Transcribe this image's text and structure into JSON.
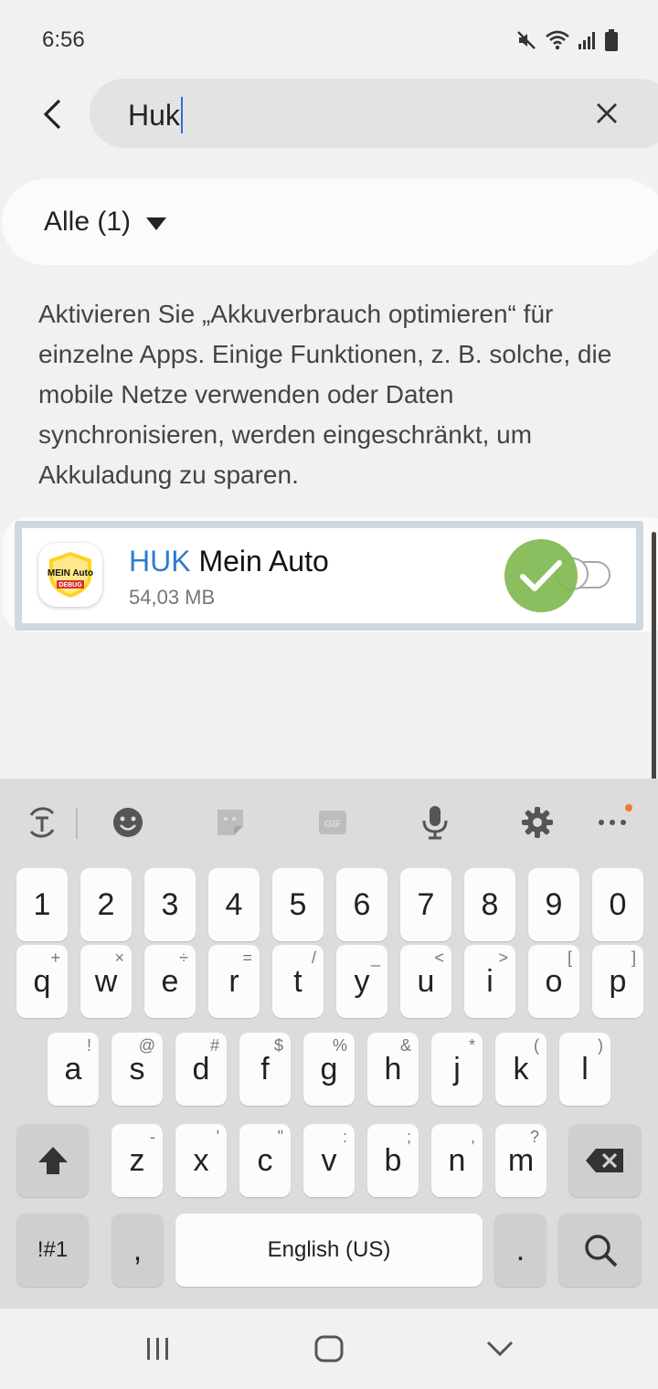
{
  "status": {
    "time": "6:56"
  },
  "search": {
    "query": "Huk"
  },
  "filter": {
    "label": "Alle (1)"
  },
  "description": "Aktivieren Sie „Akkuverbrauch optimieren“ für einzelne Apps. Einige Funktionen, z. B. solche, die mobile Netze verwenden oder Daten synchronisieren, werden eingeschränkt, um Akkuladung zu sparen.",
  "app": {
    "name_highlight": "HUK",
    "name_rest": " Mein Auto",
    "size": "54,03 MB",
    "icon_text_top": "MEIN Auto",
    "icon_text_bottom": "DEBUG",
    "toggle_on": false
  },
  "keyboard": {
    "numbers": [
      "1",
      "2",
      "3",
      "4",
      "5",
      "6",
      "7",
      "8",
      "9",
      "0"
    ],
    "row1": [
      {
        "k": "q",
        "s": "+"
      },
      {
        "k": "w",
        "s": "×"
      },
      {
        "k": "e",
        "s": "÷"
      },
      {
        "k": "r",
        "s": "="
      },
      {
        "k": "t",
        "s": "/"
      },
      {
        "k": "y",
        "s": "_"
      },
      {
        "k": "u",
        "s": "<"
      },
      {
        "k": "i",
        "s": ">"
      },
      {
        "k": "o",
        "s": "["
      },
      {
        "k": "p",
        "s": "]"
      }
    ],
    "row2": [
      {
        "k": "a",
        "s": "!"
      },
      {
        "k": "s",
        "s": "@"
      },
      {
        "k": "d",
        "s": "#"
      },
      {
        "k": "f",
        "s": "$"
      },
      {
        "k": "g",
        "s": "%"
      },
      {
        "k": "h",
        "s": "&"
      },
      {
        "k": "j",
        "s": "*"
      },
      {
        "k": "k",
        "s": "("
      },
      {
        "k": "l",
        "s": ")"
      }
    ],
    "row3": [
      {
        "k": "z",
        "s": "-"
      },
      {
        "k": "x",
        "s": "'"
      },
      {
        "k": "c",
        "s": "\""
      },
      {
        "k": "v",
        "s": ":"
      },
      {
        "k": "b",
        "s": ";"
      },
      {
        "k": "n",
        "s": ","
      },
      {
        "k": "m",
        "s": "?"
      }
    ],
    "symbols_label": "!#1",
    "comma": ",",
    "space_label": "English (US)",
    "period": "."
  }
}
